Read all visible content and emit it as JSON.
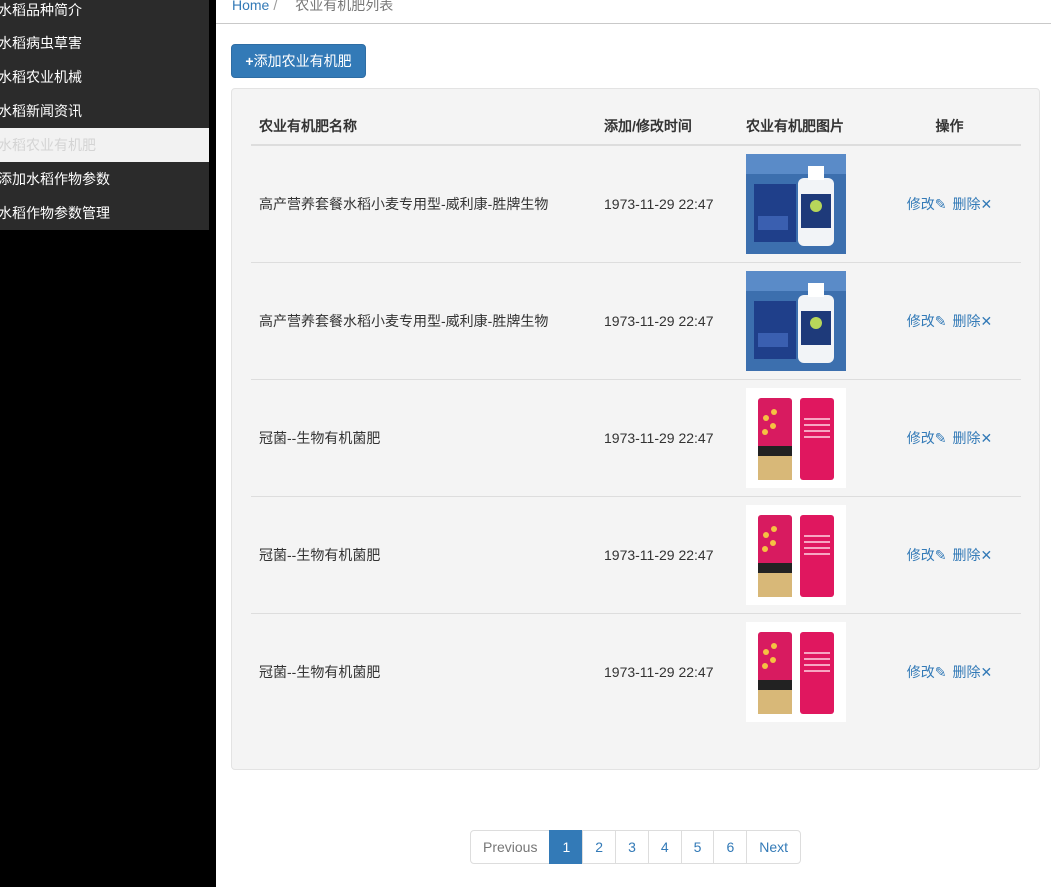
{
  "sidebar": {
    "items": [
      {
        "label": "水稻品种简介"
      },
      {
        "label": "水稻病虫草害"
      },
      {
        "label": "水稻农业机械"
      },
      {
        "label": "水稻新闻资讯"
      },
      {
        "label": "水稻农业有机肥"
      },
      {
        "label": "添加水稻作物参数"
      },
      {
        "label": "水稻作物参数管理"
      }
    ]
  },
  "breadcrumb": {
    "home": "Home",
    "separator": "/",
    "current": "农业有机肥列表"
  },
  "add_button": {
    "plus": "+",
    "label": "添加农业有机肥"
  },
  "table": {
    "headers": {
      "name": "农业有机肥名称",
      "time": "添加/修改时间",
      "image": "农业有机肥图片",
      "ops": "操作"
    },
    "rows": [
      {
        "name": "高产营养套餐水稻小麦专用型-威利康-胜牌生物",
        "time": "1973-11-29 22:47",
        "image": "bottle-box"
      },
      {
        "name": "高产营养套餐水稻小麦专用型-威利康-胜牌生物",
        "time": "1973-11-29 22:47",
        "image": "bottle-box"
      },
      {
        "name": "冠菌--生物有机菌肥",
        "time": "1973-11-29 22:47",
        "image": "fertilizer-bags"
      },
      {
        "name": "冠菌--生物有机菌肥",
        "time": "1973-11-29 22:47",
        "image": "fertilizer-bags"
      },
      {
        "name": "冠菌--生物有机菌肥",
        "time": "1973-11-29 22:47",
        "image": "fertilizer-bags"
      }
    ],
    "edit_label": "修改",
    "edit_icon": "✎",
    "delete_label": "删除",
    "delete_icon": "✕"
  },
  "pagination": {
    "prev": "Previous",
    "pages": [
      "1",
      "2",
      "3",
      "4",
      "5",
      "6"
    ],
    "active": "1",
    "next": "Next"
  },
  "colors": {
    "primary": "#337ab7",
    "sidebar_bg": "#2b2b2b",
    "panel_bg": "#f4f4f4"
  }
}
